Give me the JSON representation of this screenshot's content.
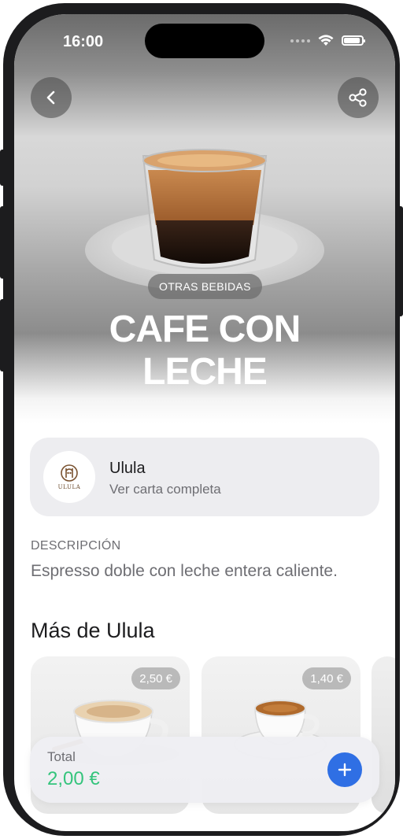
{
  "status_bar": {
    "time": "16:00"
  },
  "hero": {
    "category": "OTRAS BEBIDAS",
    "title_line1": "CAFE CON",
    "title_line2": "LECHE"
  },
  "restaurant": {
    "name": "Ulula",
    "link": "Ver carta completa",
    "logo_text": "ULULA"
  },
  "description": {
    "label": "DESCRIPCIÓN",
    "text": "Espresso doble con leche entera caliente."
  },
  "more_section": {
    "title": "Más de Ulula",
    "items": [
      {
        "price": "2,50 €"
      },
      {
        "price": "1,40 €"
      }
    ]
  },
  "total": {
    "label": "Total",
    "value": "2,00 €"
  },
  "colors": {
    "accent_blue": "#2f6fe4",
    "price_green": "#34c47c"
  }
}
